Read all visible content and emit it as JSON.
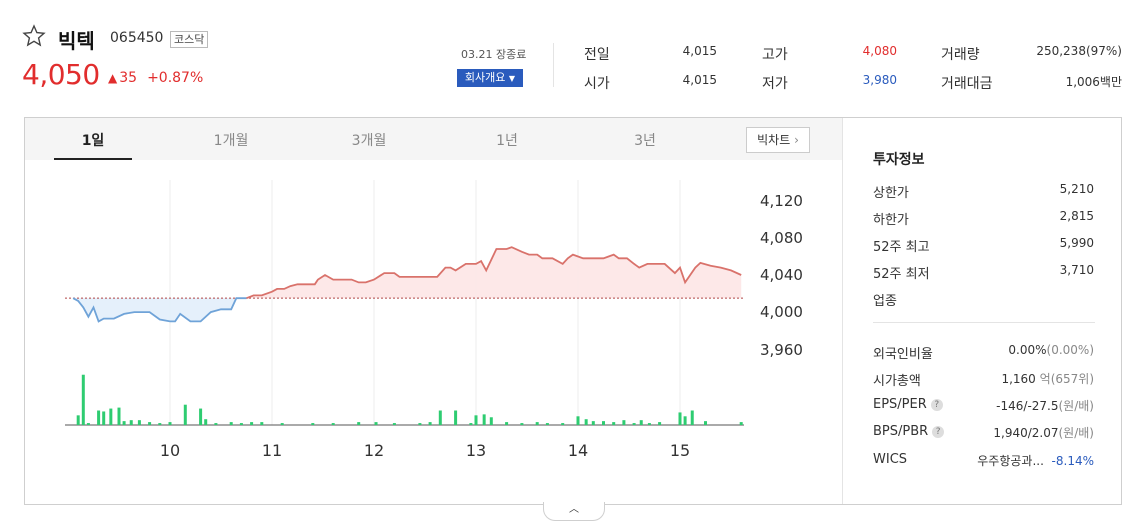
{
  "header": {
    "name": "빅텍",
    "code": "065450",
    "market": "코스닥",
    "price": "4,050",
    "change": "35",
    "change_pct": "+0.87%",
    "date": "03.21 장종료",
    "company_btn": "회사개요"
  },
  "quote": {
    "prev_label": "전일",
    "prev": "4,015",
    "open_label": "시가",
    "open": "4,015",
    "high_label": "고가",
    "high": "4,080",
    "low_label": "저가",
    "low": "3,980",
    "vol_label": "거래량",
    "vol": "250,238(97%)",
    "amt_label": "거래대금",
    "amt": "1,006백만"
  },
  "tabs": [
    "1일",
    "1개월",
    "3개월",
    "1년",
    "3년"
  ],
  "bigchart_label": "빅차트",
  "chart_data": {
    "type": "area",
    "title": "",
    "baseline": 4015,
    "ylim": [
      3950,
      4135
    ],
    "yticks": [
      "4,120",
      "4,080",
      "4,040",
      "4,000",
      "3,960"
    ],
    "ytick_values": [
      4120,
      4080,
      4040,
      4000,
      3960
    ],
    "xticks": [
      "10",
      "11",
      "12",
      "13",
      "14",
      "15"
    ],
    "xtick_values": [
      10,
      11,
      12,
      13,
      14,
      15
    ],
    "xlim": [
      9.05,
      15.7
    ],
    "prices": [
      [
        9.05,
        4015
      ],
      [
        9.1,
        4012
      ],
      [
        9.15,
        4005
      ],
      [
        9.2,
        3995
      ],
      [
        9.25,
        4005
      ],
      [
        9.3,
        3990
      ],
      [
        9.35,
        3993
      ],
      [
        9.45,
        3993
      ],
      [
        9.55,
        3998
      ],
      [
        9.65,
        4000
      ],
      [
        9.8,
        4000
      ],
      [
        9.9,
        3992
      ],
      [
        10.0,
        3990
      ],
      [
        10.05,
        3990
      ],
      [
        10.1,
        3998
      ],
      [
        10.2,
        3990
      ],
      [
        10.3,
        3990
      ],
      [
        10.4,
        4000
      ],
      [
        10.5,
        4003
      ],
      [
        10.6,
        4003
      ],
      [
        10.65,
        4015
      ],
      [
        10.75,
        4015
      ],
      [
        10.82,
        4018
      ],
      [
        10.9,
        4018
      ],
      [
        11.0,
        4022
      ],
      [
        11.05,
        4025
      ],
      [
        11.12,
        4025
      ],
      [
        11.18,
        4028
      ],
      [
        11.25,
        4030
      ],
      [
        11.35,
        4030
      ],
      [
        11.42,
        4030
      ],
      [
        11.45,
        4035
      ],
      [
        11.52,
        4040
      ],
      [
        11.6,
        4035
      ],
      [
        11.7,
        4035
      ],
      [
        11.78,
        4035
      ],
      [
        11.85,
        4032
      ],
      [
        11.92,
        4032
      ],
      [
        12.0,
        4035
      ],
      [
        12.1,
        4042
      ],
      [
        12.2,
        4042
      ],
      [
        12.25,
        4038
      ],
      [
        12.35,
        4038
      ],
      [
        12.5,
        4038
      ],
      [
        12.62,
        4038
      ],
      [
        12.7,
        4048
      ],
      [
        12.75,
        4048
      ],
      [
        12.8,
        4045
      ],
      [
        12.9,
        4052
      ],
      [
        13.0,
        4052
      ],
      [
        13.05,
        4055
      ],
      [
        13.1,
        4045
      ],
      [
        13.2,
        4068
      ],
      [
        13.25,
        4068
      ],
      [
        13.3,
        4068
      ],
      [
        13.35,
        4070
      ],
      [
        13.45,
        4065
      ],
      [
        13.52,
        4062
      ],
      [
        13.6,
        4062
      ],
      [
        13.65,
        4058
      ],
      [
        13.75,
        4058
      ],
      [
        13.85,
        4052
      ],
      [
        13.9,
        4058
      ],
      [
        13.95,
        4062
      ],
      [
        14.05,
        4058
      ],
      [
        14.15,
        4058
      ],
      [
        14.25,
        4058
      ],
      [
        14.3,
        4060
      ],
      [
        14.35,
        4062
      ],
      [
        14.4,
        4058
      ],
      [
        14.48,
        4058
      ],
      [
        14.55,
        4052
      ],
      [
        14.6,
        4048
      ],
      [
        14.68,
        4052
      ],
      [
        14.75,
        4052
      ],
      [
        14.85,
        4052
      ],
      [
        14.95,
        4042
      ],
      [
        15.0,
        4048
      ],
      [
        15.05,
        4032
      ],
      [
        15.15,
        4048
      ],
      [
        15.2,
        4053
      ],
      [
        15.3,
        4050
      ],
      [
        15.4,
        4048
      ],
      [
        15.5,
        4045
      ],
      [
        15.6,
        4040
      ]
    ],
    "volumes": [
      [
        9.1,
        10
      ],
      [
        9.15,
        52
      ],
      [
        9.2,
        2
      ],
      [
        9.3,
        15
      ],
      [
        9.35,
        14
      ],
      [
        9.42,
        17
      ],
      [
        9.5,
        18
      ],
      [
        9.55,
        4
      ],
      [
        9.62,
        5
      ],
      [
        9.7,
        5
      ],
      [
        9.8,
        3
      ],
      [
        9.9,
        2
      ],
      [
        10.0,
        3
      ],
      [
        10.15,
        21
      ],
      [
        10.3,
        17
      ],
      [
        10.35,
        6
      ],
      [
        10.45,
        2
      ],
      [
        10.6,
        3
      ],
      [
        10.7,
        2
      ],
      [
        10.8,
        3
      ],
      [
        10.9,
        3
      ],
      [
        11.1,
        2
      ],
      [
        11.4,
        2
      ],
      [
        11.6,
        2
      ],
      [
        11.85,
        3
      ],
      [
        12.02,
        3
      ],
      [
        12.2,
        2
      ],
      [
        12.45,
        2
      ],
      [
        12.55,
        3
      ],
      [
        12.65,
        15
      ],
      [
        12.8,
        15
      ],
      [
        12.95,
        2
      ],
      [
        13.0,
        10
      ],
      [
        13.08,
        11
      ],
      [
        13.15,
        8
      ],
      [
        13.3,
        3
      ],
      [
        13.45,
        2
      ],
      [
        13.6,
        3
      ],
      [
        13.7,
        2
      ],
      [
        13.85,
        2
      ],
      [
        14.0,
        9
      ],
      [
        14.08,
        6
      ],
      [
        14.15,
        4
      ],
      [
        14.25,
        4
      ],
      [
        14.35,
        3
      ],
      [
        14.45,
        5
      ],
      [
        14.55,
        2
      ],
      [
        14.62,
        5
      ],
      [
        14.7,
        2
      ],
      [
        14.8,
        3
      ],
      [
        15.0,
        13
      ],
      [
        15.05,
        9
      ],
      [
        15.12,
        15
      ],
      [
        15.25,
        4
      ],
      [
        15.6,
        3
      ]
    ],
    "up_color": "#d9726b",
    "down_color": "#6fa3d8",
    "volume_color": "#2ecc71"
  },
  "invest": {
    "title": "투자정보",
    "upper_label": "상한가",
    "upper": "5,210",
    "lower_label": "하한가",
    "lower": "2,815",
    "w52h_label": "52주 최고",
    "w52h": "5,990",
    "w52l_label": "52주 최저",
    "w52l": "3,710",
    "sector_label": "업종",
    "foreign_label": "외국인비율",
    "foreign": "0.00%",
    "foreign2": "(0.00%)",
    "mcap_label": "시가총액",
    "mcap": "1,160",
    "mcap_unit": "억",
    "mcap_rank": "(657위)",
    "eps_label": "EPS/PER",
    "eps": "-146/-27.5",
    "eps_unit": "(원/배)",
    "bps_label": "BPS/PBR",
    "bps": "1,940/2.07",
    "bps_unit": "(원/배)",
    "wics_label": "WICS",
    "wics": "우주항공과...",
    "wics_pct": "-8.14%"
  }
}
